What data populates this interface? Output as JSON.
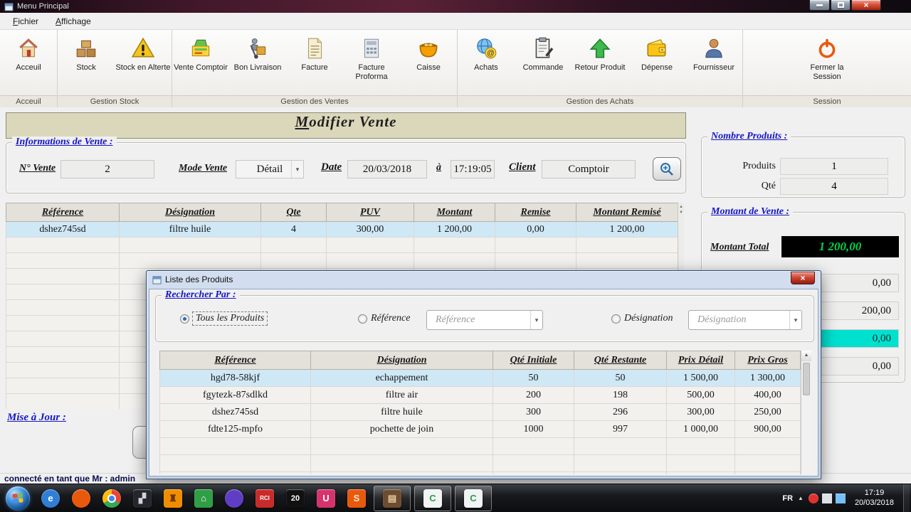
{
  "colors": {
    "accent-blue": "#1515c8",
    "row-highlight": "#cfe8f6",
    "money-green": "#00d248",
    "cyan-box": "#00e0cf",
    "title-panel-bg": "#dbd7ba"
  },
  "window": {
    "title": "Menu Principal",
    "menu": [
      {
        "label": "Fichier"
      },
      {
        "label": "Affichage"
      }
    ]
  },
  "toolbar": {
    "groups": [
      {
        "label": "Acceuil",
        "items": [
          {
            "label": "Acceuil",
            "icon": "home"
          }
        ]
      },
      {
        "label": "Gestion Stock",
        "items": [
          {
            "label": "Stock",
            "icon": "stock"
          },
          {
            "label": "Stock en Alterte",
            "icon": "alert"
          }
        ]
      },
      {
        "label": "Gestion des Ventes",
        "items": [
          {
            "label": "Vente Comptoir",
            "icon": "vente"
          },
          {
            "label": "Bon Livraison",
            "icon": "livraison"
          },
          {
            "label": "Facture",
            "icon": "facture"
          },
          {
            "label": "Facture Proforma",
            "icon": "proforma"
          },
          {
            "label": "Caisse",
            "icon": "caisse"
          }
        ]
      },
      {
        "label": "Gestion des Achats",
        "items": [
          {
            "label": "Achats",
            "icon": "achats"
          },
          {
            "label": "Commande",
            "icon": "commande"
          },
          {
            "label": "Retour Produit",
            "icon": "retour"
          },
          {
            "label": "Dépense",
            "icon": "depense"
          },
          {
            "label": "Fournisseur",
            "icon": "fournisseur"
          }
        ]
      },
      {
        "label": "Session",
        "items": [
          {
            "label": "Fermer la Session",
            "icon": "session"
          }
        ]
      }
    ]
  },
  "form": {
    "title": "Modifier Vente",
    "group_label": "Informations de Vente :",
    "num_vente": {
      "label": "N° Vente",
      "value": "2"
    },
    "mode_vente": {
      "label": "Mode Vente",
      "value": "Détail"
    },
    "date": {
      "label": "Date",
      "value": "20/03/2018"
    },
    "time": {
      "label": "à",
      "value": "17:19:05"
    },
    "client": {
      "label": "Client",
      "value": "Comptoir"
    },
    "update_label": "Mise à Jour :"
  },
  "sale_grid": {
    "headers": [
      "Référence",
      "Désignation",
      "Qte",
      "PUV",
      "Montant",
      "Remise",
      "Montant Remisé"
    ],
    "rows": [
      [
        "dshez745sd",
        "filtre huile",
        "4",
        "300,00",
        "1 200,00",
        "0,00",
        "1 200,00"
      ]
    ]
  },
  "totals": {
    "nombre_produits_label": "Nombre Produits :",
    "produits": {
      "label": "Produits",
      "value": "1"
    },
    "qte": {
      "label": "Qté",
      "value": "4"
    },
    "montant_vente_label": "Montant de Vente :",
    "montant_total": {
      "label": "Montant Total",
      "value": "1 200,00"
    },
    "partial_values": [
      {
        "value": "0,00"
      },
      {
        "value": "200,00"
      },
      {
        "value": "0,00",
        "highlight": true
      },
      {
        "value": "0,00"
      }
    ]
  },
  "status": {
    "text": "connecté en tant que Mr : admin"
  },
  "dialog": {
    "title": "Liste des Produits",
    "group_label": "Rechercher Par :",
    "radios": [
      {
        "label": "Tous les Produits",
        "selected": true
      },
      {
        "label": "Référence",
        "selected": false
      },
      {
        "label": "Désignation",
        "selected": false
      }
    ],
    "reference_placeholder": "Référence",
    "designation_placeholder": "Désignation",
    "grid": {
      "headers": [
        "Référence",
        "Désignation",
        "Qté Initiale",
        "Qté Restante",
        "Prix Détail",
        "Prix Gros"
      ],
      "rows": [
        [
          "hgd78-58kjf",
          "echappement",
          "50",
          "50",
          "1 500,00",
          "1 300,00"
        ],
        [
          "fgytezk-87sdlkd",
          "filtre air",
          "200",
          "198",
          "500,00",
          "400,00"
        ],
        [
          "dshez745sd",
          "filtre huile",
          "300",
          "296",
          "300,00",
          "250,00"
        ],
        [
          "fdte125-mpfo",
          "pochette de join",
          "1000",
          "997",
          "1 000,00",
          "900,00"
        ]
      ]
    }
  },
  "taskbar": {
    "apps": [
      {
        "name": "internet-explorer",
        "glyph": "e",
        "bg": "#2f7fd6",
        "fg": "#ffffff",
        "shape": "circle"
      },
      {
        "name": "browser-orange",
        "glyph": "",
        "bg": "#e8590c",
        "fg": "#ffffff",
        "shape": "circle"
      },
      {
        "name": "chrome",
        "glyph": "",
        "bg": "chrome",
        "fg": "#ffffff",
        "shape": "circle"
      },
      {
        "name": "dark-app",
        "glyph": "▞",
        "bg": "#23262b",
        "fg": "#cfd4da",
        "shape": "square"
      },
      {
        "name": "castle-app",
        "glyph": "♜",
        "bg": "#f08c00",
        "fg": "#6b3400",
        "shape": "square"
      },
      {
        "name": "homegroup",
        "glyph": "⌂",
        "bg": "#2f9e44",
        "fg": "#ffffff",
        "shape": "square"
      },
      {
        "name": "sphere-app",
        "glyph": "",
        "bg": "#5f3dc4",
        "fg": "#b197fc",
        "shape": "circle"
      },
      {
        "name": "rci-app",
        "glyph": "RCI",
        "bg": "#c92a2a",
        "fg": "#ffffff",
        "shape": "square"
      },
      {
        "name": "app-20",
        "glyph": "20",
        "bg": "#111111",
        "fg": "#ffffff",
        "shape": "square"
      },
      {
        "name": "u-app",
        "glyph": "U",
        "bg": "#d6336c",
        "fg": "#ffffff",
        "shape": "square"
      },
      {
        "name": "sublime-text",
        "glyph": "S",
        "bg": "#e8590c",
        "fg": "#ffe8cc",
        "shape": "square"
      },
      {
        "name": "app-window",
        "glyph": "▤",
        "bg": "#6d4c2f",
        "fg": "#e2c9a0",
        "shape": "square",
        "active": true
      },
      {
        "name": "c-app-1",
        "glyph": "C",
        "bg": "#f1f3f5",
        "fg": "#2f9e44",
        "shape": "square",
        "active": true
      },
      {
        "name": "c-app-2",
        "glyph": "C",
        "bg": "#f1f3f5",
        "fg": "#2f9e44",
        "shape": "square",
        "active": true
      }
    ],
    "tray_icons": [
      {
        "name": "notification",
        "color": "#e03131",
        "shape": "circle"
      },
      {
        "name": "input",
        "color": "#dee2e6",
        "shape": "square"
      },
      {
        "name": "network",
        "color": "#74c0fc",
        "shape": "square"
      }
    ],
    "tray": {
      "language": "FR",
      "time": "17:19",
      "date": "20/03/2018"
    }
  }
}
